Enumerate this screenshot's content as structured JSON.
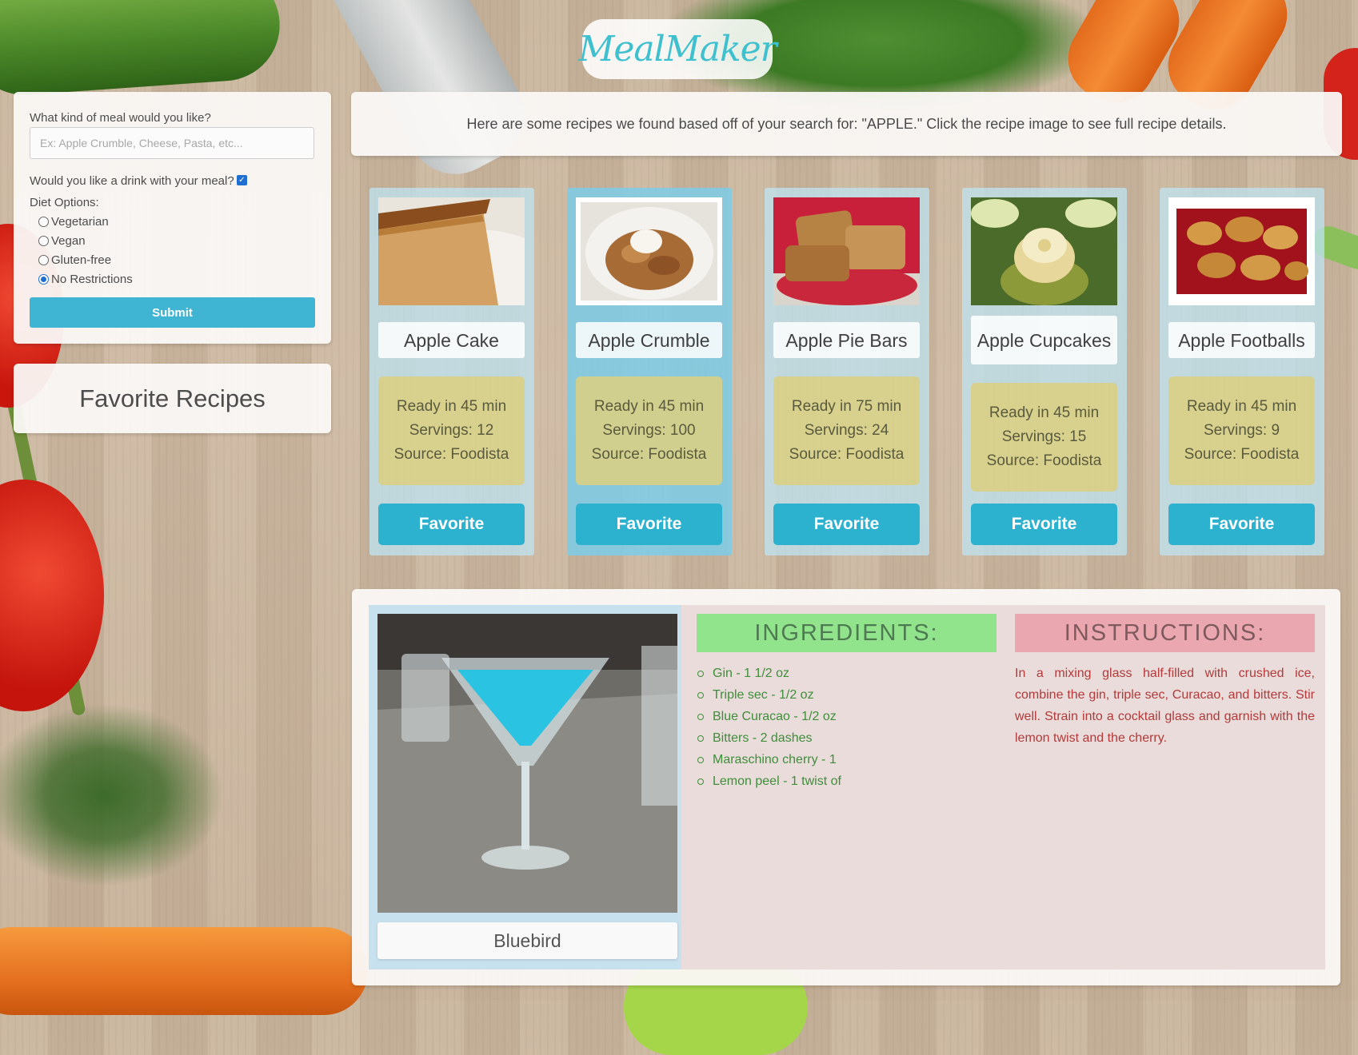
{
  "app": {
    "logo_text": "MealMaker"
  },
  "search": {
    "question": "What kind of meal would you like?",
    "placeholder": "Ex: Apple Crumble, Cheese, Pasta, etc...",
    "value": "",
    "drink_label": "Would you like a drink with your meal?",
    "drink_checked": true,
    "diet_label": "Diet Options:",
    "diet_options": [
      {
        "label": "Vegetarian",
        "selected": false
      },
      {
        "label": "Vegan",
        "selected": false
      },
      {
        "label": "Gluten-free",
        "selected": false
      },
      {
        "label": "No Restrictions",
        "selected": true
      }
    ],
    "submit_label": "Submit"
  },
  "favorites": {
    "title": "Favorite Recipes"
  },
  "results": {
    "message": "Here are some recipes we found based off of your search for: \"APPLE.\" Click the recipe image to see full recipe details."
  },
  "recipes": [
    {
      "title": "Apple Cake",
      "ready": "Ready in 45 min",
      "servings": "Servings: 12",
      "source": "Source: Foodista",
      "favorite_label": "Favorite",
      "active": false
    },
    {
      "title": "Apple Crumble",
      "ready": "Ready in 45 min",
      "servings": "Servings: 100",
      "source": "Source: Foodista",
      "favorite_label": "Favorite",
      "active": true
    },
    {
      "title": "Apple Pie Bars",
      "ready": "Ready in 75 min",
      "servings": "Servings: 24",
      "source": "Source: Foodista",
      "favorite_label": "Favorite",
      "active": false
    },
    {
      "title": "Apple Cupcakes",
      "ready": "Ready in 45 min",
      "servings": "Servings: 15",
      "source": "Source: Foodista",
      "favorite_label": "Favorite",
      "active": false
    },
    {
      "title": "Apple Footballs",
      "ready": "Ready in 45 min",
      "servings": "Servings: 9",
      "source": "Source: Foodista",
      "favorite_label": "Favorite",
      "active": false
    }
  ],
  "drink": {
    "name": "Bluebird",
    "ingredients_header": "INGREDIENTS:",
    "instructions_header": "INSTRUCTIONS:",
    "ingredients": [
      "Gin - 1 1/2 oz",
      "Triple sec - 1/2 oz",
      "Blue Curacao - 1/2 oz",
      "Bitters - 2 dashes",
      "Maraschino cherry - 1",
      "Lemon peel - 1 twist of"
    ],
    "instructions": "In a mixing glass half-filled with crushed ice, combine the gin, triple sec, Curacao, and bitters. Stir well. Strain into a cocktail glass and garnish with the lemon twist and the cherry."
  },
  "colors": {
    "accent": "#3fb5d3",
    "ingredients_header": "#91e38c",
    "instructions_header": "#eba7af",
    "info_box": "#dbcf82",
    "card_bg": "#bee4f2"
  }
}
